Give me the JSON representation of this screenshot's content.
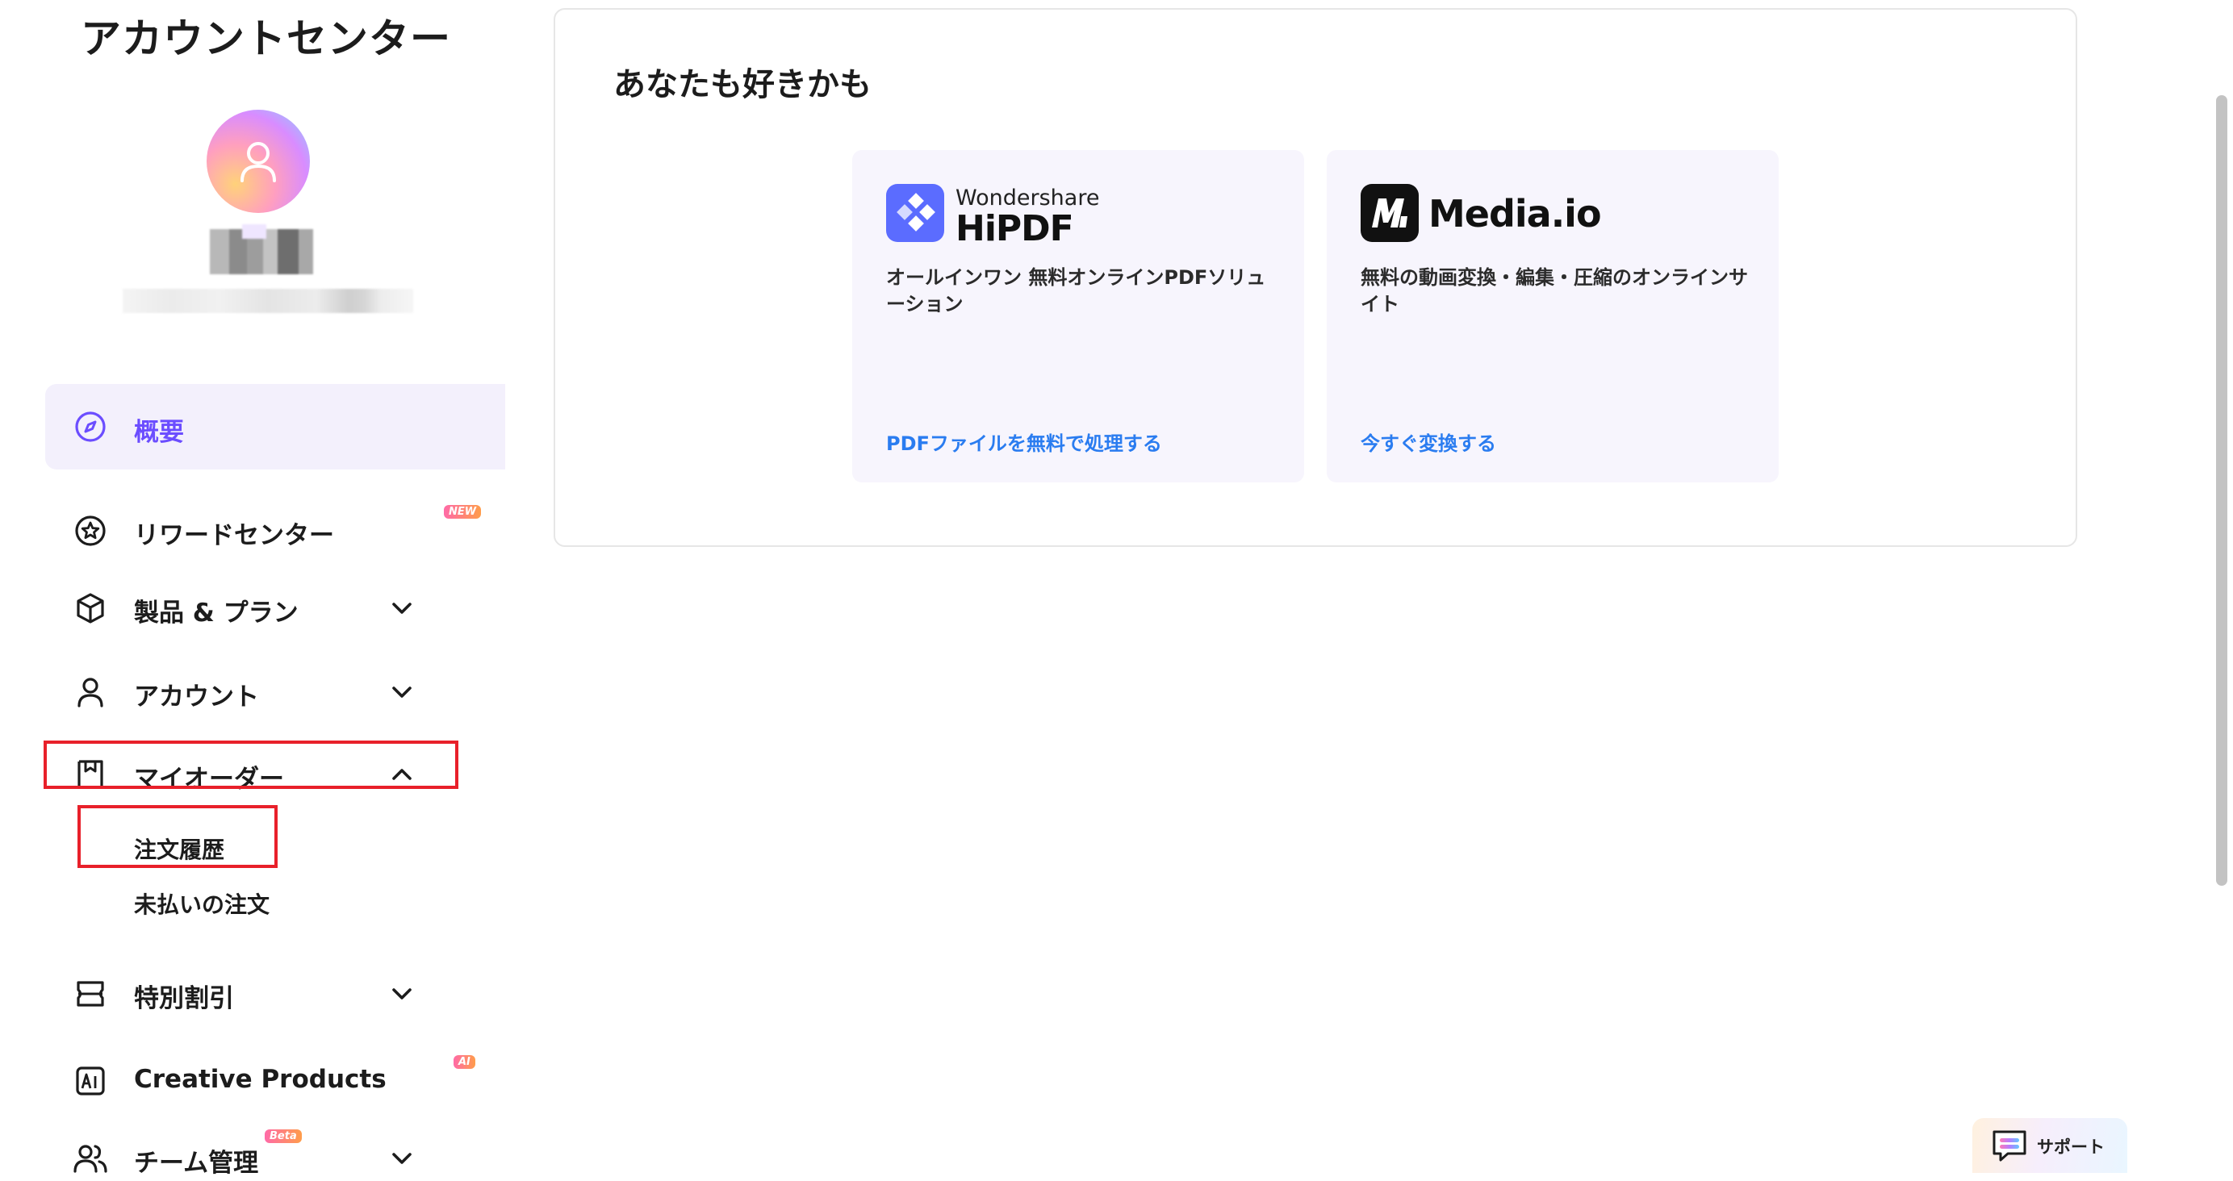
{
  "sidebar": {
    "title": "アカウントセンター",
    "items": [
      {
        "label": "概要",
        "icon": "compass-icon",
        "active": true
      },
      {
        "label": "リワードセンター",
        "icon": "star-badge-icon",
        "badge": "NEW"
      },
      {
        "label": "製品 & プラン",
        "icon": "cube-icon",
        "expandable": true
      },
      {
        "label": "アカウント",
        "icon": "person-icon",
        "expandable": true
      },
      {
        "label": "マイオーダー",
        "icon": "receipt-icon",
        "expanded": true
      },
      {
        "label": "特別割引",
        "icon": "ticket-icon",
        "expandable": true
      },
      {
        "label": "Creative Products",
        "icon": "ai-square-icon",
        "badge": "AI"
      },
      {
        "label": "チーム管理",
        "icon": "people-icon",
        "badge": "Beta",
        "expandable": true
      }
    ],
    "order_subitems": [
      "注文履歴",
      "未払いの注文"
    ]
  },
  "main": {
    "section_title": "あなたも好きかも",
    "products": [
      {
        "brand_small": "Wondershare",
        "brand": "HiPDF",
        "description": "オールインワン 無料オンラインPDFソリューション",
        "link": "PDFファイルを無料で処理する",
        "accent_color": "#5b6cff"
      },
      {
        "brand": "Media.io",
        "description": "無料の動画変換・編集・圧縮のオンラインサイト",
        "link": "今すぐ変換する",
        "accent_color": "#111111"
      }
    ]
  },
  "support": {
    "label": "サポート"
  },
  "colors": {
    "accent": "#6b4dff",
    "link": "#2a7cf0",
    "highlight": "#e8202a",
    "active_bg": "#f3f0fc"
  }
}
